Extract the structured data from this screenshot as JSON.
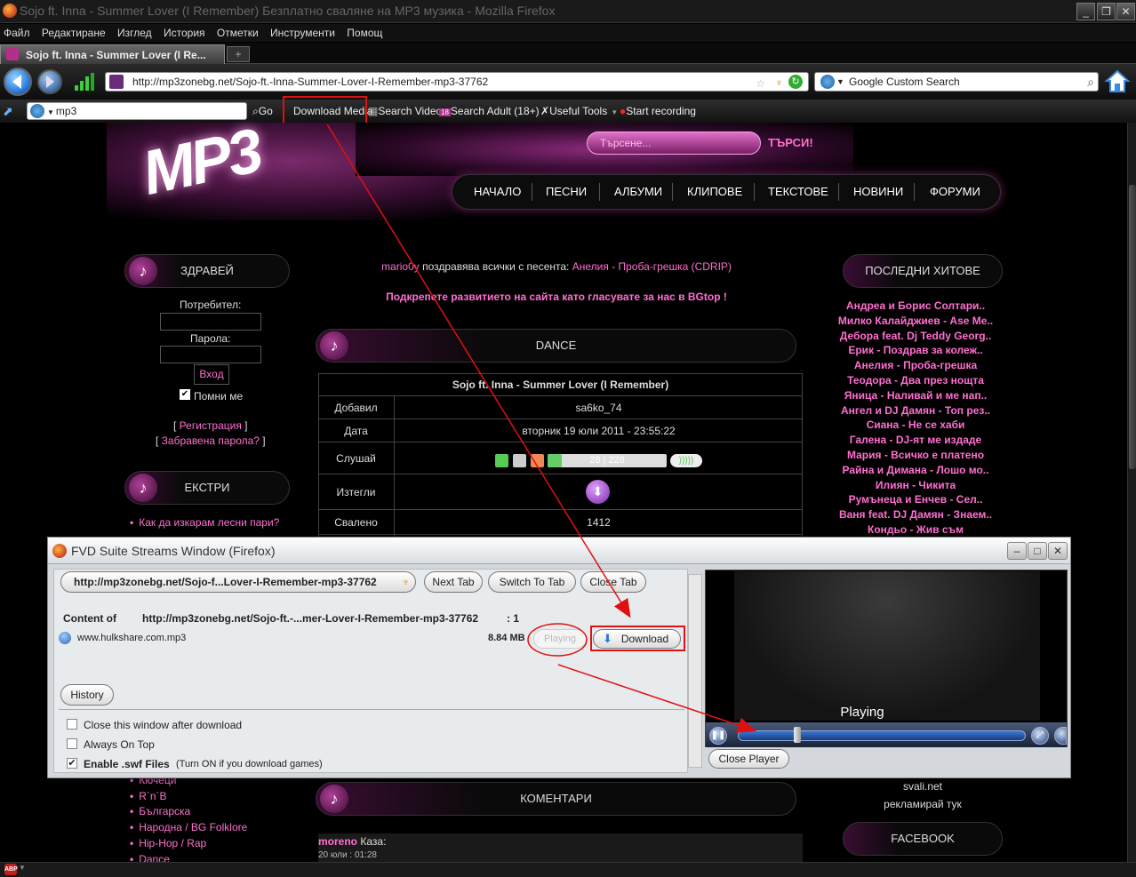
{
  "window": {
    "title": "Sojo ft. Inna - Summer Lover (I Remember) Безплатно сваляне на MP3 музика - Mozilla Firefox",
    "controls": [
      "_",
      "❐",
      "✕"
    ]
  },
  "menu": [
    "Файл",
    "Редактиране",
    "Изглед",
    "История",
    "Отметки",
    "Инструменти",
    "Помощ"
  ],
  "tab": {
    "label": "Sojo ft. Inna - Summer Lover (I Re...",
    "new_tab": "+"
  },
  "address": {
    "url": "http://mp3zonebg.net/Sojo-ft.-Inna-Summer-Lover-I-Remember-mp3-37762"
  },
  "search_engine": {
    "placeholder": "Google Custom Search"
  },
  "toolbar2": {
    "search_value": "mp3",
    "go": "Go",
    "download_media": "Download Media",
    "search_video": "Search Video",
    "search_adult": "Search Adult (18+)",
    "useful_tools": "Useful Tools",
    "start_recording": "Start recording"
  },
  "site": {
    "search_placeholder": "Търсене...",
    "search_button": "ТЪРСИ!",
    "nav": [
      "НАЧАЛО",
      "ПЕСНИ",
      "АЛБУМИ",
      "КЛИПОВЕ",
      "ТЕКСТОВЕ",
      "НОВИНИ",
      "ФОРУМИ"
    ]
  },
  "left": {
    "hello_title": "ЗДРАВЕЙ",
    "user_label": "Потребител:",
    "pass_label": "Парола:",
    "login": "Вход",
    "remember": "Помни ме",
    "register": "Регистрация",
    "forgot": "Забравена парола?",
    "extras_title": "ЕКСТРИ",
    "extras_item": "Как да изкарам лесни пари?",
    "categories": [
      "Кючеци",
      "R`n`B",
      "Българска",
      "Народна / BG Folklore",
      "Hip-Hop / Rap",
      "Dance"
    ]
  },
  "center": {
    "greeting_user": "mario0y",
    "greeting_text": "поздравява всички с песента:",
    "greeting_song": "Анелия - Проба-грешка (CDRIP)",
    "support": "Подкрепете развитието на сайта като гласувате за нас в BGtop !",
    "genre": "DANCE",
    "song_title": "Sojo ft. Inna - Summer Lover (I Remember)",
    "rows": [
      {
        "k": "Добавил",
        "v": "sa6ko_74"
      },
      {
        "k": "Дата",
        "v": "вторник 19 юли 2011 - 23:55:22"
      },
      {
        "k": "Слушай",
        "v": ""
      },
      {
        "k": "Изтегли",
        "v": ""
      },
      {
        "k": "Свалено",
        "v": "1412"
      }
    ],
    "player_time": "28 | 228",
    "comments_title": "КОМЕНТАРИ",
    "comment_user": "moreno",
    "comment_said": "Каза:",
    "comment_date": "20 юли : 01:28"
  },
  "right": {
    "hits_title": "ПОСЛЕДНИ ХИТОВЕ",
    "hits": [
      "Андреа и Борис Солтари..",
      "Милко Калайджиев - Ase Me..",
      "Дебора feat. Dj Teddy Georg..",
      "Ерик - Поздрав за колеж..",
      "Анелия - Проба-грешка",
      "Теодора - Два през нощта",
      "Яница - Наливай и ме нап..",
      "Ангел и DJ Дамян - Топ рез..",
      "Сиана - Не се хаби",
      "Галена - DJ-ят ме издаде",
      "Мария - Всичко е платено",
      "Райна и Димана - Лошо мо..",
      "Илиян - Чикита",
      "Румънеца и Енчев - Сел..",
      "Ваня feat. DJ Дамян - Знаем..",
      "Кондьо - Жив съм"
    ],
    "link1": "svali.net",
    "link2": "рекламирай тук",
    "facebook_title": "FACEBOOK"
  },
  "fvd": {
    "title": "FVD Suite Streams Window (Firefox)",
    "url_field": "http://mp3zonebg.net/Sojo-f...Lover-I-Remember-mp3-37762",
    "next_tab": "Next Tab",
    "switch_tab": "Switch To Tab",
    "close_tab": "Close Tab",
    "content_of_label": "Content of",
    "content_of_url": "http://mp3zonebg.net/Sojo-ft.-...mer-Lover-I-Remember-mp3-37762",
    "content_count": ": 1",
    "file_name": "www.hulkshare.com.mp3",
    "file_size": "8.84 MB",
    "playing_btn": "Playing",
    "download_btn": "Download",
    "history": "History",
    "opt_close": "Close this window after download",
    "opt_ontop": "Always On Top",
    "opt_swf": "Enable .swf Files",
    "opt_swf_note": "(Turn ON if you download games)",
    "player_status": "Playing",
    "close_player": "Close Player"
  },
  "status": {
    "abp": "ABP"
  }
}
